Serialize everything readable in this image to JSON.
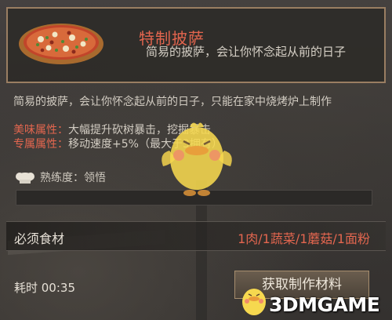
{
  "item": {
    "title": "特制披萨",
    "subtitle": "简易的披萨，会让你怀念起从前的日子",
    "description": "简易的披萨，会让你怀念起从前的日子，只能在家中烧烤炉上制作",
    "icon": "pizza-icon"
  },
  "attributes": [
    {
      "label": "美味属性：",
      "value": "大幅提升砍树暴击，挖掘暴击"
    },
    {
      "label": "专属属性：",
      "value": "移动速度+5%（最大于3拥有）"
    }
  ],
  "proficiency": {
    "icon": "chef-hat-icon",
    "text": "熟练度：领悟",
    "progress": 0.0
  },
  "ingredients": {
    "label": "必须食材",
    "value": "1肉/1蔬菜/1蘑菇/1面粉"
  },
  "time": {
    "text": "耗时 00:35"
  },
  "gather_button": {
    "label": "获取制作材料"
  },
  "watermark": {
    "text": "3DMGAME",
    "icon": "chick-mascot-icon"
  },
  "colors": {
    "accent_red": "#e3654e",
    "frame_border": "#9a7e62",
    "panel_bg": "#2e2b28"
  }
}
